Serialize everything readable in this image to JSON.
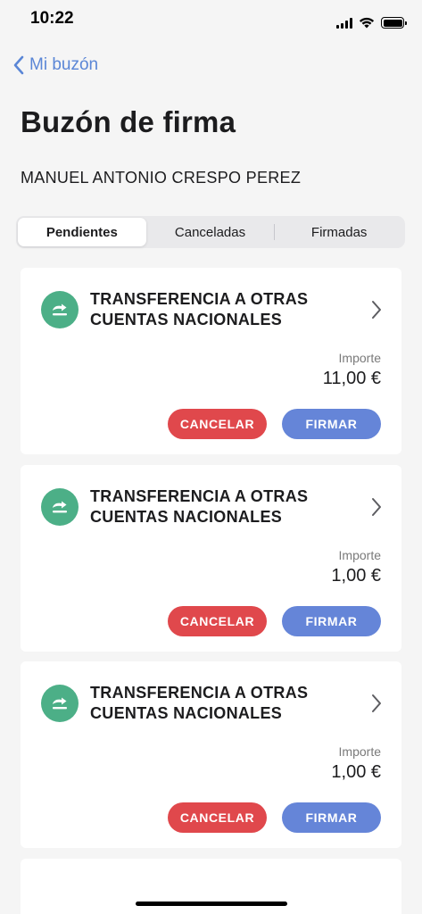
{
  "status_bar": {
    "time": "10:22"
  },
  "nav": {
    "back_label": "Mi buzón"
  },
  "page": {
    "title": "Buzón de firma",
    "user_name": "MANUEL ANTONIO CRESPO PEREZ"
  },
  "tabs": [
    {
      "label": "Pendientes",
      "active": true
    },
    {
      "label": "Canceladas",
      "active": false
    },
    {
      "label": "Firmadas",
      "active": false
    }
  ],
  "cards": [
    {
      "title": "TRANSFERENCIA A OTRAS CUENTAS NACIONALES",
      "amount_label": "Importe",
      "amount": "11,00 €",
      "cancel_label": "CANCELAR",
      "sign_label": "FIRMAR",
      "icon": "transfer-icon"
    },
    {
      "title": "TRANSFERENCIA A OTRAS CUENTAS NACIONALES",
      "amount_label": "Importe",
      "amount": "1,00 €",
      "cancel_label": "CANCELAR",
      "sign_label": "FIRMAR",
      "icon": "transfer-icon"
    },
    {
      "title": "TRANSFERENCIA A OTRAS CUENTAS NACIONALES",
      "amount_label": "Importe",
      "amount": "1,00 €",
      "cancel_label": "CANCELAR",
      "sign_label": "FIRMAR",
      "icon": "transfer-icon"
    }
  ],
  "colors": {
    "accent": "#5a86d6",
    "icon_bg": "#4caf87",
    "cancel": "#e0484c",
    "sign": "#6585d8",
    "background": "#f5f5f5"
  }
}
